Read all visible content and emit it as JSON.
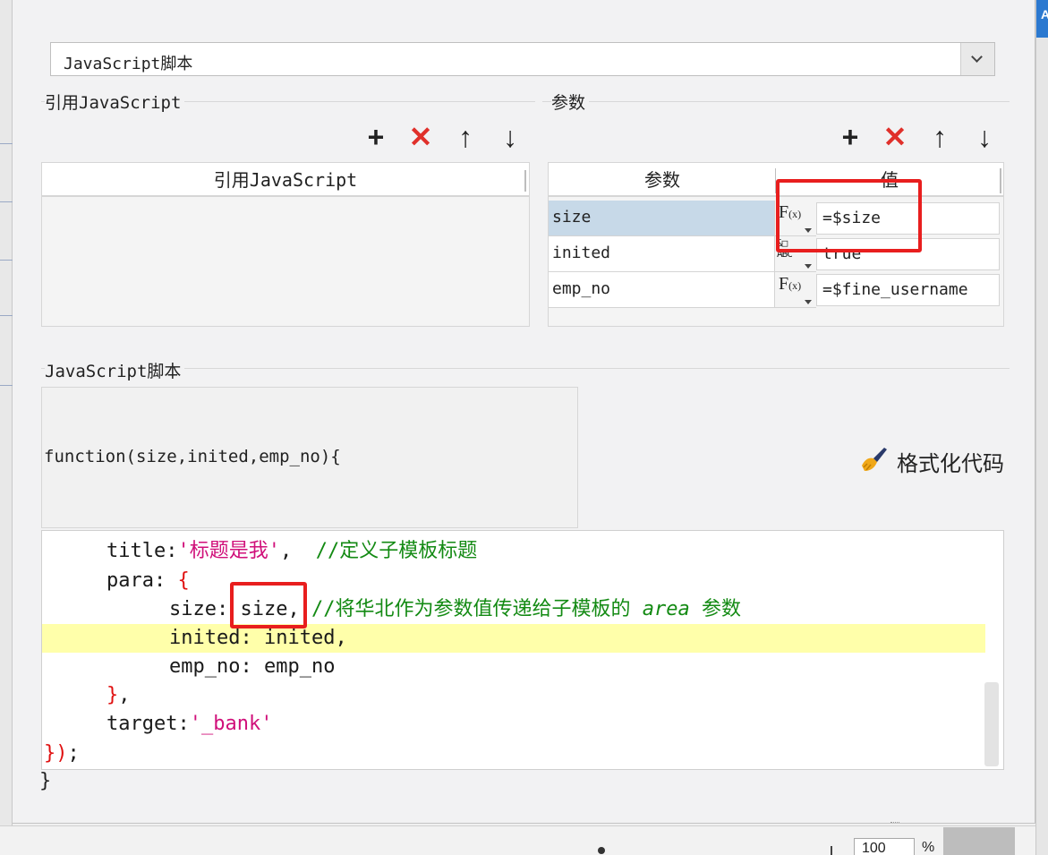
{
  "script_type_select": {
    "value": "JavaScript脚本"
  },
  "ref_js": {
    "group_title": "引用JavaScript",
    "column_header": "引用JavaScript",
    "toolbar": {
      "add": "+",
      "delete": "✕",
      "up": "↑",
      "down": "↓"
    }
  },
  "params": {
    "group_title": "参数",
    "header_name": "参数",
    "header_value": "值",
    "toolbar": {
      "add": "+",
      "delete": "✕",
      "up": "↑",
      "down": "↓"
    },
    "rows": [
      {
        "name": "size",
        "type_icon": "formula-icon",
        "value": "=$size"
      },
      {
        "name": "inited",
        "type_icon": "text-type-icon",
        "value": "true"
      },
      {
        "name": "emp_no",
        "type_icon": "formula-icon",
        "value": "=$fine_username"
      }
    ]
  },
  "script": {
    "group_title": "JavaScript脚本",
    "signature": "function(size,inited,emp_no){",
    "format_button": "格式化代码",
    "closing": "}",
    "code": {
      "l1_key": "title:",
      "l1_str": "'标题是我'",
      "l1_sep": ",  ",
      "l1_comment": "//定义子模板标题",
      "l2_key": "para: ",
      "l2_brace": "{",
      "l3_key": "size: ",
      "l3_val": "size",
      "l3_sep": ", ",
      "l3_comment_a": "//将华北作为参数值传递给子模板的 ",
      "l3_comment_b": "area",
      "l3_comment_c": " 参数",
      "l4_key": "inited: ",
      "l4_val": "inited,",
      "l5_key": "emp_no: ",
      "l5_val": "emp_no",
      "l6_brace": "}",
      "l6_sep": ",",
      "l7_key": "target:",
      "l7_str": "'_bank'",
      "l8_brace": "})",
      "l8_semi": ";"
    }
  },
  "status_bar": {
    "zoom_value": "100",
    "zoom_unit": "%"
  },
  "colors": {
    "highlight_box": "#e81e1e",
    "selected_row": "#c7d9e8",
    "active_line": "#ffffaa",
    "comment": "#138a13",
    "string": "#d0107a"
  }
}
